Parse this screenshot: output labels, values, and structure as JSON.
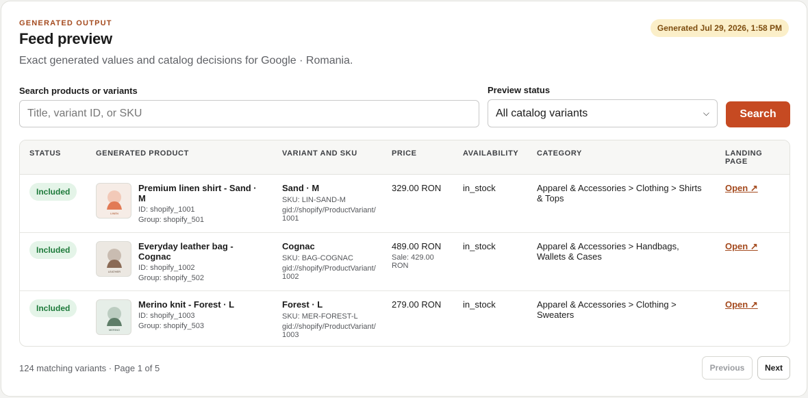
{
  "header": {
    "eyebrow": "GENERATED OUTPUT",
    "title": "Feed preview",
    "subtitle": "Exact generated values and catalog decisions for Google · Romania.",
    "generated_badge": "Generated Jul 29, 2026, 1:58 PM"
  },
  "filters": {
    "search_label": "Search products or variants",
    "search_placeholder": "Title, variant ID, or SKU",
    "search_value": "",
    "status_label": "Preview status",
    "status_selected": "All catalog variants",
    "search_button": "Search"
  },
  "table": {
    "headers": {
      "status": "STATUS",
      "product": "GENERATED PRODUCT",
      "variant": "VARIANT AND SKU",
      "price": "PRICE",
      "availability": "AVAILABILITY",
      "category": "CATEGORY",
      "landing_line1": "LANDING",
      "landing_line2": "PAGE"
    },
    "rows": [
      {
        "status": "Included",
        "thumb_label": "LINEN",
        "thumb_color": "#e27a55",
        "thumb_bg": "#f6ece6",
        "name": "Premium linen shirt - Sand · M",
        "id": "ID: shopify_1001",
        "group": "Group: shopify_501",
        "variant": "Sand · M",
        "sku": "SKU: LIN-SAND-M",
        "gid": "gid://shopify/ProductVariant/1001",
        "price": "329.00 RON",
        "sale": "",
        "availability": "in_stock",
        "category": "Apparel & Accessories > Clothing > Shirts & Tops",
        "landing": "Open ↗"
      },
      {
        "status": "Included",
        "thumb_label": "LEATHER",
        "thumb_color": "#8a6a55",
        "thumb_bg": "#ece8e2",
        "name": "Everyday leather bag - Cognac",
        "id": "ID: shopify_1002",
        "group": "Group: shopify_502",
        "variant": "Cognac",
        "sku": "SKU: BAG-COGNAC",
        "gid": "gid://shopify/ProductVariant/1002",
        "price": "489.00 RON",
        "sale": "Sale: 429.00 RON",
        "availability": "in_stock",
        "category": "Apparel & Accessories > Handbags, Wallets & Cases",
        "landing": "Open ↗"
      },
      {
        "status": "Included",
        "thumb_label": "MERINO",
        "thumb_color": "#5e7d68",
        "thumb_bg": "#e6eee8",
        "name": "Merino knit - Forest · L",
        "id": "ID: shopify_1003",
        "group": "Group: shopify_503",
        "variant": "Forest · L",
        "sku": "SKU: MER-FOREST-L",
        "gid": "gid://shopify/ProductVariant/1003",
        "price": "279.00 RON",
        "sale": "",
        "availability": "in_stock",
        "category": "Apparel & Accessories > Clothing > Sweaters",
        "landing": "Open ↗"
      }
    ]
  },
  "footer": {
    "summary": "124 matching variants · Page 1 of 5",
    "previous": "Previous",
    "next": "Next"
  }
}
